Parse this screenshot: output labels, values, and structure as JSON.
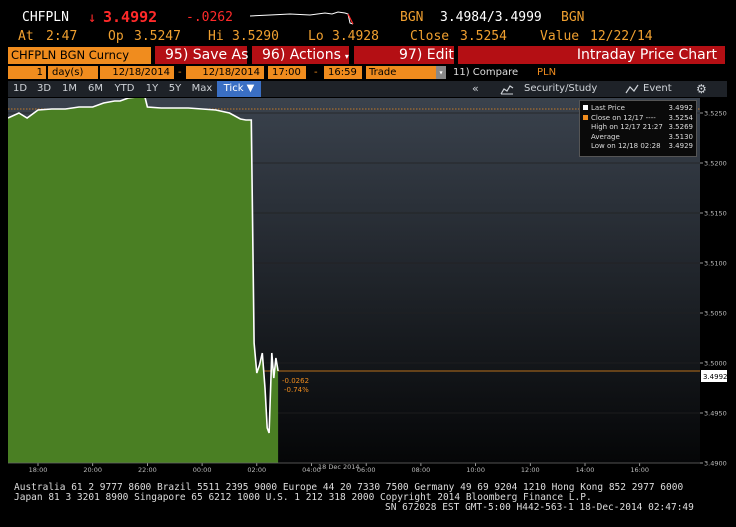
{
  "header": {
    "ticker": "CHFPLN",
    "arrow": "↓",
    "last": "3.4992",
    "change": "-.0262",
    "source_label": "BGN",
    "bid_ask": "3.4984/3.4999",
    "source_label2": "BGN",
    "at_label": "At",
    "at_time": "2:47",
    "op_label": "Op",
    "op_val": "3.5247",
    "hi_label": "Hi",
    "hi_val": "3.5290",
    "lo_label": "Lo",
    "lo_val": "3.4928",
    "close_label": "Close",
    "close_val": "3.5254",
    "value_label": "Value",
    "value_date": "12/22/14"
  },
  "toolbar": {
    "security": "CHFPLN BGN Curncy",
    "save": "95) Save As",
    "actions": "96) Actions",
    "edit": "97) Edit",
    "title": "Intraday Price Chart"
  },
  "params": {
    "period_num": "1",
    "period_unit": "day(s)",
    "start_date": "12/18/2014",
    "dash1": "-",
    "end_date": "12/18/2014",
    "start_time": "17:00",
    "dash2": "-",
    "end_time": "16:59",
    "mode": "Trade",
    "compare": "11) Compare",
    "currency": "PLN"
  },
  "tabs": [
    "1D",
    "3D",
    "1M",
    "6M",
    "YTD",
    "1Y",
    "5Y",
    "Max",
    "Tick ▼"
  ],
  "rightbar": {
    "collapse": "«",
    "study": "Security/Study",
    "event": "Event"
  },
  "legend": [
    {
      "label": "Last Price",
      "value": "3.4992",
      "color": "#ffffff"
    },
    {
      "label": "Close on 12/17 ---- ",
      "value": "3.5254",
      "color": "#f08c1e"
    },
    {
      "label": "High on 12/17 21:27",
      "value": "3.5269",
      "color": "#ffffff"
    },
    {
      "label": "Average",
      "value": "3.5130",
      "color": "#ffffff"
    },
    {
      "label": "Low on 12/18 02:28",
      "value": "3.4929",
      "color": "#ffffff"
    }
  ],
  "annotations": {
    "change": "-0.0262",
    "pct": "-0.74%",
    "last_tag": "3.4992",
    "date_label": "18 Dec 2014"
  },
  "colors": {
    "area": "#4a7f23",
    "line": "#ffffff",
    "close": "#f08c1e",
    "amber": "#f0a030",
    "red": "#ff2a2a"
  },
  "chart_data": {
    "type": "area",
    "x_ticks": [
      "18:00",
      "20:00",
      "22:00",
      "00:00",
      "02:00",
      "04:00",
      "06:00",
      "08:00",
      "10:00",
      "12:00",
      "14:00",
      "16:00"
    ],
    "y_ticks": [
      "3.5250",
      "3.5200",
      "3.5150",
      "3.5100",
      "3.5050",
      "3.5000",
      "3.4950",
      "3.4900"
    ],
    "ylim": [
      3.49,
      3.5265
    ],
    "reference_close": 3.5254,
    "series": [
      {
        "name": "Last Price",
        "points": [
          [
            17.0,
            3.5245
          ],
          [
            17.3,
            3.525
          ],
          [
            17.6,
            3.5245
          ],
          [
            18.0,
            3.5253
          ],
          [
            18.5,
            3.5254
          ],
          [
            19.0,
            3.5254
          ],
          [
            19.5,
            3.5256
          ],
          [
            20.0,
            3.5256
          ],
          [
            20.4,
            3.526
          ],
          [
            20.8,
            3.5262
          ],
          [
            21.0,
            3.5262
          ],
          [
            21.3,
            3.5265
          ],
          [
            21.6,
            3.5266
          ],
          [
            21.9,
            3.5267
          ],
          [
            22.0,
            3.5256
          ],
          [
            22.5,
            3.5255
          ],
          [
            23.0,
            3.5255
          ],
          [
            23.5,
            3.5255
          ],
          [
            24.0,
            3.5254
          ],
          [
            24.5,
            3.5253
          ],
          [
            25.0,
            3.525
          ],
          [
            25.4,
            3.5244
          ],
          [
            25.6,
            3.5243
          ],
          [
            25.8,
            3.5243
          ],
          [
            25.9,
            3.502
          ],
          [
            26.0,
            3.499
          ],
          [
            26.1,
            3.4998
          ],
          [
            26.2,
            3.501
          ],
          [
            26.3,
            3.4975
          ],
          [
            26.38,
            3.4935
          ],
          [
            26.45,
            3.493
          ],
          [
            26.55,
            3.501
          ],
          [
            26.62,
            3.4985
          ],
          [
            26.7,
            3.5005
          ],
          [
            26.78,
            3.4992
          ]
        ]
      }
    ]
  },
  "footer": {
    "line1": "Australia 61 2 9777 8600 Brazil 5511 2395 9000 Europe 44 20 7330 7500 Germany 49 69 9204 1210 Hong Kong 852 2977 6000",
    "line2": "Japan 81 3 3201 8900      Singapore 65 6212 1000      U.S. 1 212 318 2000        Copyright 2014 Bloomberg Finance L.P.",
    "line3": "SN 672028 EST  GMT-5:00 H442-563-1 18-Dec-2014 02:47:49"
  }
}
